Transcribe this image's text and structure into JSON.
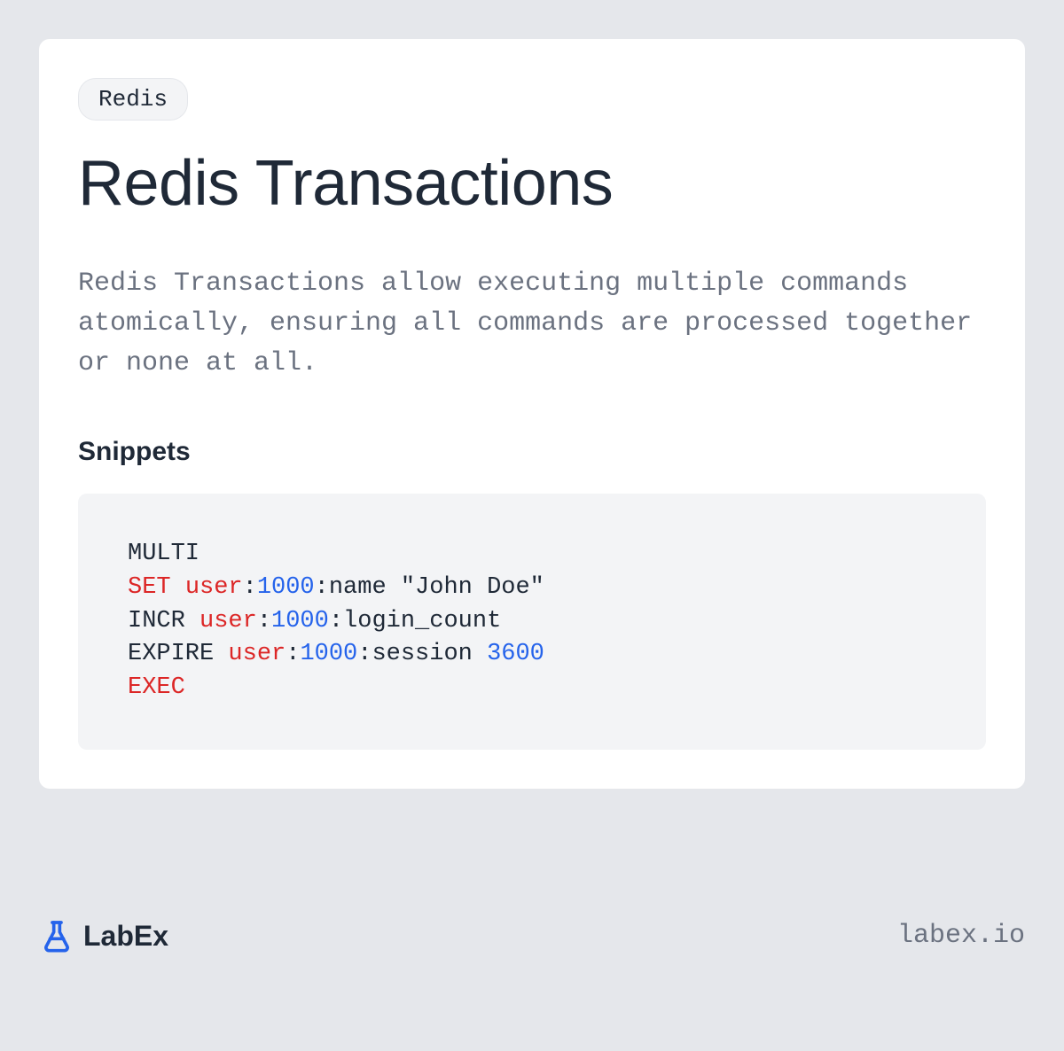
{
  "tag": "Redis",
  "title": "Redis Transactions",
  "description": "Redis Transactions allow executing multiple commands atomically, ensuring all commands are processed together or none at all.",
  "snippets_heading": "Snippets",
  "code": {
    "line1": "MULTI",
    "line2_set": "SET",
    "line2_user": "user",
    "line2_colon1": ":",
    "line2_num": "1000",
    "line2_rest": ":name \"John Doe\"",
    "line3_incr": "INCR ",
    "line3_user": "user",
    "line3_colon1": ":",
    "line3_num": "1000",
    "line3_rest": ":login_count",
    "line4_expire": "EXPIRE ",
    "line4_user": "user",
    "line4_colon1": ":",
    "line4_num": "1000",
    "line4_rest": ":session ",
    "line4_seconds": "3600",
    "line5_exec": "EXEC"
  },
  "footer": {
    "brand": "LabEx",
    "url": "labex.io"
  }
}
